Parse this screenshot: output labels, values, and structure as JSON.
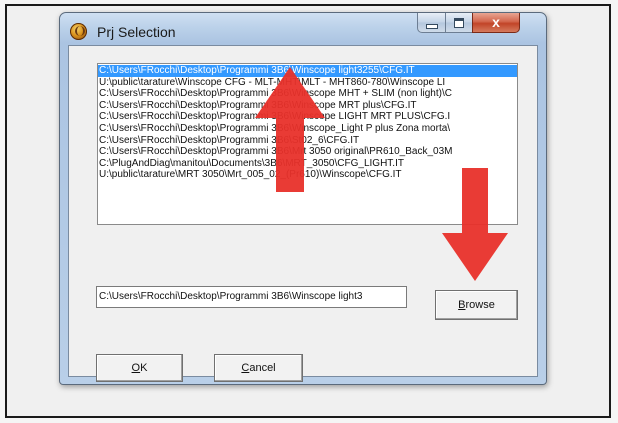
{
  "window": {
    "title": "Prj Selection",
    "caption_buttons": {
      "minimize_icon": "minimize-icon",
      "maximize_icon": "maximize-icon",
      "close_icon": "close-icon",
      "close_label": "x"
    }
  },
  "listbox": {
    "selected_index": 0,
    "items": [
      "C:\\Users\\FRocchi\\Desktop\\Programmi 3B6\\Winscope light3255\\CFG.IT",
      "U:\\public\\tarature\\Winscope CFG - MLT-MHT\\MLT - MHT860-780\\Winscope LI",
      "C:\\Users\\FRocchi\\Desktop\\Programmi 3B6\\Winscope MHT + SLIM (non light)\\C",
      "C:\\Users\\FRocchi\\Desktop\\Programmi 3B6\\Winscope MRT plus\\CFG.IT",
      "C:\\Users\\FRocchi\\Desktop\\Programmi 3B6\\Winscope LIGHT MRT PLUS\\CFG.I",
      "C:\\Users\\FRocchi\\Desktop\\Programmi 3B6\\Winscope_Light P plus Zona morta\\",
      "C:\\Users\\FRocchi\\Desktop\\Programmi 3B6\\St02_6\\CFG.IT",
      "C:\\Users\\FRocchi\\Desktop\\Programmi 3B6\\Mrt 3050 original\\PR610_Back_03M",
      "C:\\PlugAndDiag\\manitou\\Documents\\3B6\\MRT_3050\\CFG_LIGHT.IT",
      "U:\\public\\tarature\\MRT 3050\\Mrt_005_02_(Pr610)\\Winscope\\CFG.IT"
    ]
  },
  "path_field": {
    "value": "C:\\Users\\FRocchi\\Desktop\\Programmi 3B6\\Winscope light3"
  },
  "buttons": {
    "browse": "Browse",
    "ok": "OK",
    "cancel": "Cancel"
  },
  "annotations": {
    "arrow_color": "#e8302a",
    "up_arrow": "arrow-up-icon",
    "down_arrow": "arrow-down-icon"
  }
}
